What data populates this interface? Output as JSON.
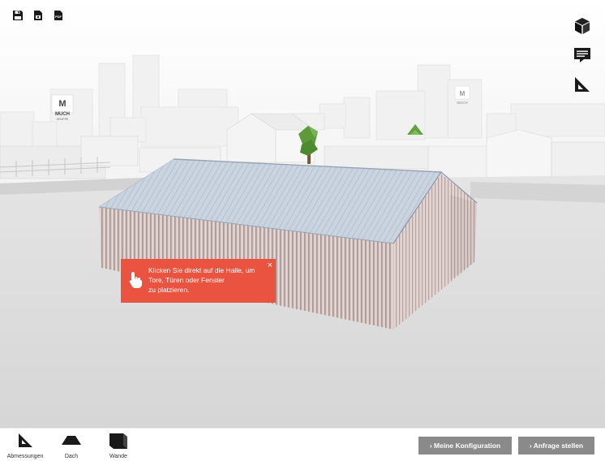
{
  "toolbar_top_left": [
    {
      "name": "save-icon",
      "icon": "floppy-disk"
    },
    {
      "name": "screenshot-icon",
      "icon": "camera-document"
    },
    {
      "name": "pdf-icon",
      "icon": "pdf-file",
      "label": "PDF"
    }
  ],
  "toolbar_top_right": [
    {
      "name": "3d-view-icon",
      "icon": "cube"
    },
    {
      "name": "comment-icon",
      "icon": "speech-bubble"
    },
    {
      "name": "measure-icon",
      "icon": "set-square"
    }
  ],
  "brand": {
    "logo_text": "MUCH",
    "logo_sub": "GRUPPE"
  },
  "tooltip": {
    "message": "Klicken Sie direkt auf die Halle, um\nTore, Türen oder Fenster\nzu platzieren.",
    "close_label": "×",
    "color": "#e9533f"
  },
  "bottom_tabs": [
    {
      "label": "Abmessungen",
      "icon": "set-square"
    },
    {
      "label": "Dach",
      "icon": "roof"
    },
    {
      "label": "Wande",
      "icon": "wall"
    }
  ],
  "actions": {
    "my_config": "› Meine Konfiguration",
    "request": "› Anfrage stellen",
    "button_color": "#8a8a8a"
  }
}
